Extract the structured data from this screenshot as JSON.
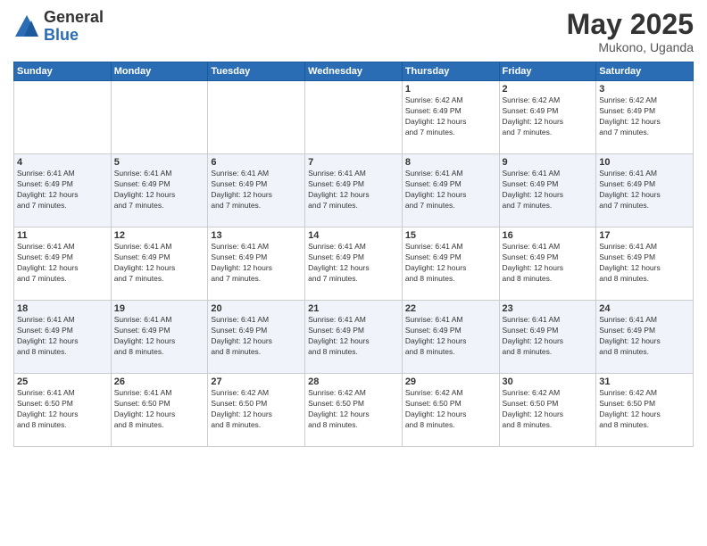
{
  "logo": {
    "general": "General",
    "blue": "Blue"
  },
  "title": {
    "month_year": "May 2025",
    "location": "Mukono, Uganda"
  },
  "days_of_week": [
    "Sunday",
    "Monday",
    "Tuesday",
    "Wednesday",
    "Thursday",
    "Friday",
    "Saturday"
  ],
  "weeks": [
    [
      {
        "day": "",
        "info": ""
      },
      {
        "day": "",
        "info": ""
      },
      {
        "day": "",
        "info": ""
      },
      {
        "day": "",
        "info": ""
      },
      {
        "day": "1",
        "info": "Sunrise: 6:42 AM\nSunset: 6:49 PM\nDaylight: 12 hours\nand 7 minutes."
      },
      {
        "day": "2",
        "info": "Sunrise: 6:42 AM\nSunset: 6:49 PM\nDaylight: 12 hours\nand 7 minutes."
      },
      {
        "day": "3",
        "info": "Sunrise: 6:42 AM\nSunset: 6:49 PM\nDaylight: 12 hours\nand 7 minutes."
      }
    ],
    [
      {
        "day": "4",
        "info": "Sunrise: 6:41 AM\nSunset: 6:49 PM\nDaylight: 12 hours\nand 7 minutes."
      },
      {
        "day": "5",
        "info": "Sunrise: 6:41 AM\nSunset: 6:49 PM\nDaylight: 12 hours\nand 7 minutes."
      },
      {
        "day": "6",
        "info": "Sunrise: 6:41 AM\nSunset: 6:49 PM\nDaylight: 12 hours\nand 7 minutes."
      },
      {
        "day": "7",
        "info": "Sunrise: 6:41 AM\nSunset: 6:49 PM\nDaylight: 12 hours\nand 7 minutes."
      },
      {
        "day": "8",
        "info": "Sunrise: 6:41 AM\nSunset: 6:49 PM\nDaylight: 12 hours\nand 7 minutes."
      },
      {
        "day": "9",
        "info": "Sunrise: 6:41 AM\nSunset: 6:49 PM\nDaylight: 12 hours\nand 7 minutes."
      },
      {
        "day": "10",
        "info": "Sunrise: 6:41 AM\nSunset: 6:49 PM\nDaylight: 12 hours\nand 7 minutes."
      }
    ],
    [
      {
        "day": "11",
        "info": "Sunrise: 6:41 AM\nSunset: 6:49 PM\nDaylight: 12 hours\nand 7 minutes."
      },
      {
        "day": "12",
        "info": "Sunrise: 6:41 AM\nSunset: 6:49 PM\nDaylight: 12 hours\nand 7 minutes."
      },
      {
        "day": "13",
        "info": "Sunrise: 6:41 AM\nSunset: 6:49 PM\nDaylight: 12 hours\nand 7 minutes."
      },
      {
        "day": "14",
        "info": "Sunrise: 6:41 AM\nSunset: 6:49 PM\nDaylight: 12 hours\nand 7 minutes."
      },
      {
        "day": "15",
        "info": "Sunrise: 6:41 AM\nSunset: 6:49 PM\nDaylight: 12 hours\nand 8 minutes."
      },
      {
        "day": "16",
        "info": "Sunrise: 6:41 AM\nSunset: 6:49 PM\nDaylight: 12 hours\nand 8 minutes."
      },
      {
        "day": "17",
        "info": "Sunrise: 6:41 AM\nSunset: 6:49 PM\nDaylight: 12 hours\nand 8 minutes."
      }
    ],
    [
      {
        "day": "18",
        "info": "Sunrise: 6:41 AM\nSunset: 6:49 PM\nDaylight: 12 hours\nand 8 minutes."
      },
      {
        "day": "19",
        "info": "Sunrise: 6:41 AM\nSunset: 6:49 PM\nDaylight: 12 hours\nand 8 minutes."
      },
      {
        "day": "20",
        "info": "Sunrise: 6:41 AM\nSunset: 6:49 PM\nDaylight: 12 hours\nand 8 minutes."
      },
      {
        "day": "21",
        "info": "Sunrise: 6:41 AM\nSunset: 6:49 PM\nDaylight: 12 hours\nand 8 minutes."
      },
      {
        "day": "22",
        "info": "Sunrise: 6:41 AM\nSunset: 6:49 PM\nDaylight: 12 hours\nand 8 minutes."
      },
      {
        "day": "23",
        "info": "Sunrise: 6:41 AM\nSunset: 6:49 PM\nDaylight: 12 hours\nand 8 minutes."
      },
      {
        "day": "24",
        "info": "Sunrise: 6:41 AM\nSunset: 6:49 PM\nDaylight: 12 hours\nand 8 minutes."
      }
    ],
    [
      {
        "day": "25",
        "info": "Sunrise: 6:41 AM\nSunset: 6:50 PM\nDaylight: 12 hours\nand 8 minutes."
      },
      {
        "day": "26",
        "info": "Sunrise: 6:41 AM\nSunset: 6:50 PM\nDaylight: 12 hours\nand 8 minutes."
      },
      {
        "day": "27",
        "info": "Sunrise: 6:42 AM\nSunset: 6:50 PM\nDaylight: 12 hours\nand 8 minutes."
      },
      {
        "day": "28",
        "info": "Sunrise: 6:42 AM\nSunset: 6:50 PM\nDaylight: 12 hours\nand 8 minutes."
      },
      {
        "day": "29",
        "info": "Sunrise: 6:42 AM\nSunset: 6:50 PM\nDaylight: 12 hours\nand 8 minutes."
      },
      {
        "day": "30",
        "info": "Sunrise: 6:42 AM\nSunset: 6:50 PM\nDaylight: 12 hours\nand 8 minutes."
      },
      {
        "day": "31",
        "info": "Sunrise: 6:42 AM\nSunset: 6:50 PM\nDaylight: 12 hours\nand 8 minutes."
      }
    ]
  ]
}
